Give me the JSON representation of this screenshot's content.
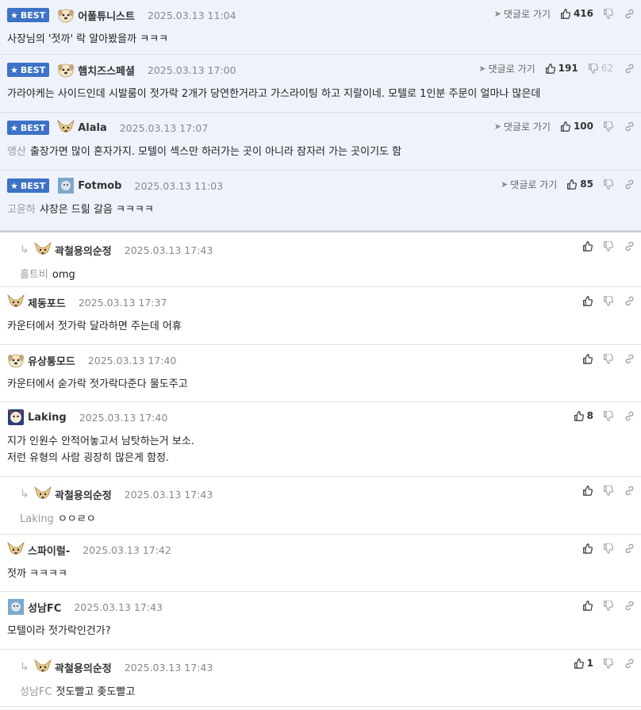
{
  "badge_label": "BEST",
  "goto_label": "댓글로 가기",
  "comments": [
    {
      "best": true,
      "nick": "어폴튜니스트",
      "date": "2025.03.13 11:04",
      "likes": "416",
      "dislikes": "",
      "goto": true,
      "avatar": "dog-face-icon",
      "mention": "",
      "lines": [
        "사장님의 '젓까' 락 알아봤을까 ㅋㅋㅋ"
      ]
    },
    {
      "best": true,
      "nick": "햄치즈스페셜",
      "date": "2025.03.13 17:00",
      "likes": "191",
      "dislikes": "62",
      "goto": true,
      "avatar": "dog-face-icon",
      "mention": "",
      "lines": [
        "가라야케는 사이드인데 시발룸이 젓가락 2개가 당연한거라고 가스라이팅 하고 지랄이네. 모텔로 1인분 주문이 얼마나 많은데"
      ]
    },
    {
      "best": true,
      "nick": "Alala",
      "date": "2025.03.13 17:07",
      "likes": "100",
      "dislikes": "",
      "goto": true,
      "avatar": "chihuahua-icon",
      "mention": "앵산",
      "lines": [
        "출장가면 많이 혼자가지. 모텔이 섹스만 하러가는 곳이 아니라 잠자러 가는 곳이기도 함"
      ]
    },
    {
      "best": true,
      "nick": "Fotmob",
      "date": "2025.03.13 11:03",
      "likes": "85",
      "dislikes": "",
      "goto": true,
      "avatar": "photo-avatar-icon",
      "mention": "고윤하",
      "lines": [
        "샤장은 드릶 갈음 ㅋㅋㅋㅋ"
      ]
    },
    {
      "best": false,
      "reply": true,
      "nick": "곽철용의순정",
      "date": "2025.03.13 17:43",
      "likes": "",
      "dislikes": "",
      "goto": false,
      "avatar": "chihuahua-icon",
      "mention": "홀트비",
      "lines": [
        "omg"
      ]
    },
    {
      "best": false,
      "reply": false,
      "nick": "제동포드",
      "date": "2025.03.13 17:37",
      "likes": "",
      "dislikes": "",
      "goto": false,
      "avatar": "chihuahua-icon",
      "mention": "",
      "lines": [
        "카운터에서 젓가락 달라하면 주는데 어휴"
      ]
    },
    {
      "best": false,
      "reply": false,
      "nick": "유상통모드",
      "date": "2025.03.13 17:40",
      "likes": "",
      "dislikes": "",
      "goto": false,
      "avatar": "dog-face-icon",
      "mention": "",
      "lines": [
        "카운터에서 숟가락 젓가락다준다 물도주고"
      ]
    },
    {
      "best": false,
      "reply": false,
      "nick": "Laking",
      "date": "2025.03.13 17:40",
      "likes": "8",
      "dislikes": "",
      "goto": false,
      "avatar": "badge-avatar-icon",
      "mention": "",
      "lines": [
        "지가 인원수 안적어놓고서 남탓하는거 보소.",
        "저런 유형의 사람 굉장히 많은게 함정."
      ]
    },
    {
      "best": false,
      "reply": true,
      "nick": "곽철용의순정",
      "date": "2025.03.13 17:43",
      "likes": "",
      "dislikes": "",
      "goto": false,
      "avatar": "chihuahua-icon",
      "mention": "Laking",
      "lines": [
        "ㅇㅇㄹㅇ"
      ]
    },
    {
      "best": false,
      "reply": false,
      "nick": "스파이럴-",
      "date": "2025.03.13 17:42",
      "likes": "",
      "dislikes": "",
      "goto": false,
      "avatar": "chihuahua-icon",
      "mention": "",
      "lines": [
        "젓까 ㅋㅋㅋㅋ"
      ]
    },
    {
      "best": false,
      "reply": false,
      "nick": "성남FC",
      "date": "2025.03.13 17:43",
      "likes": "",
      "dislikes": "",
      "goto": false,
      "avatar": "photo-avatar-icon",
      "mention": "",
      "lines": [
        "모텔이라 젓가락인건가?"
      ]
    },
    {
      "best": false,
      "reply": true,
      "nick": "곽철용의순정",
      "date": "2025.03.13 17:43",
      "likes": "1",
      "dislikes": "",
      "goto": false,
      "avatar": "chihuahua-icon",
      "mention": "성남FC",
      "lines": [
        "젓도빨고 좆도빨고"
      ]
    }
  ]
}
